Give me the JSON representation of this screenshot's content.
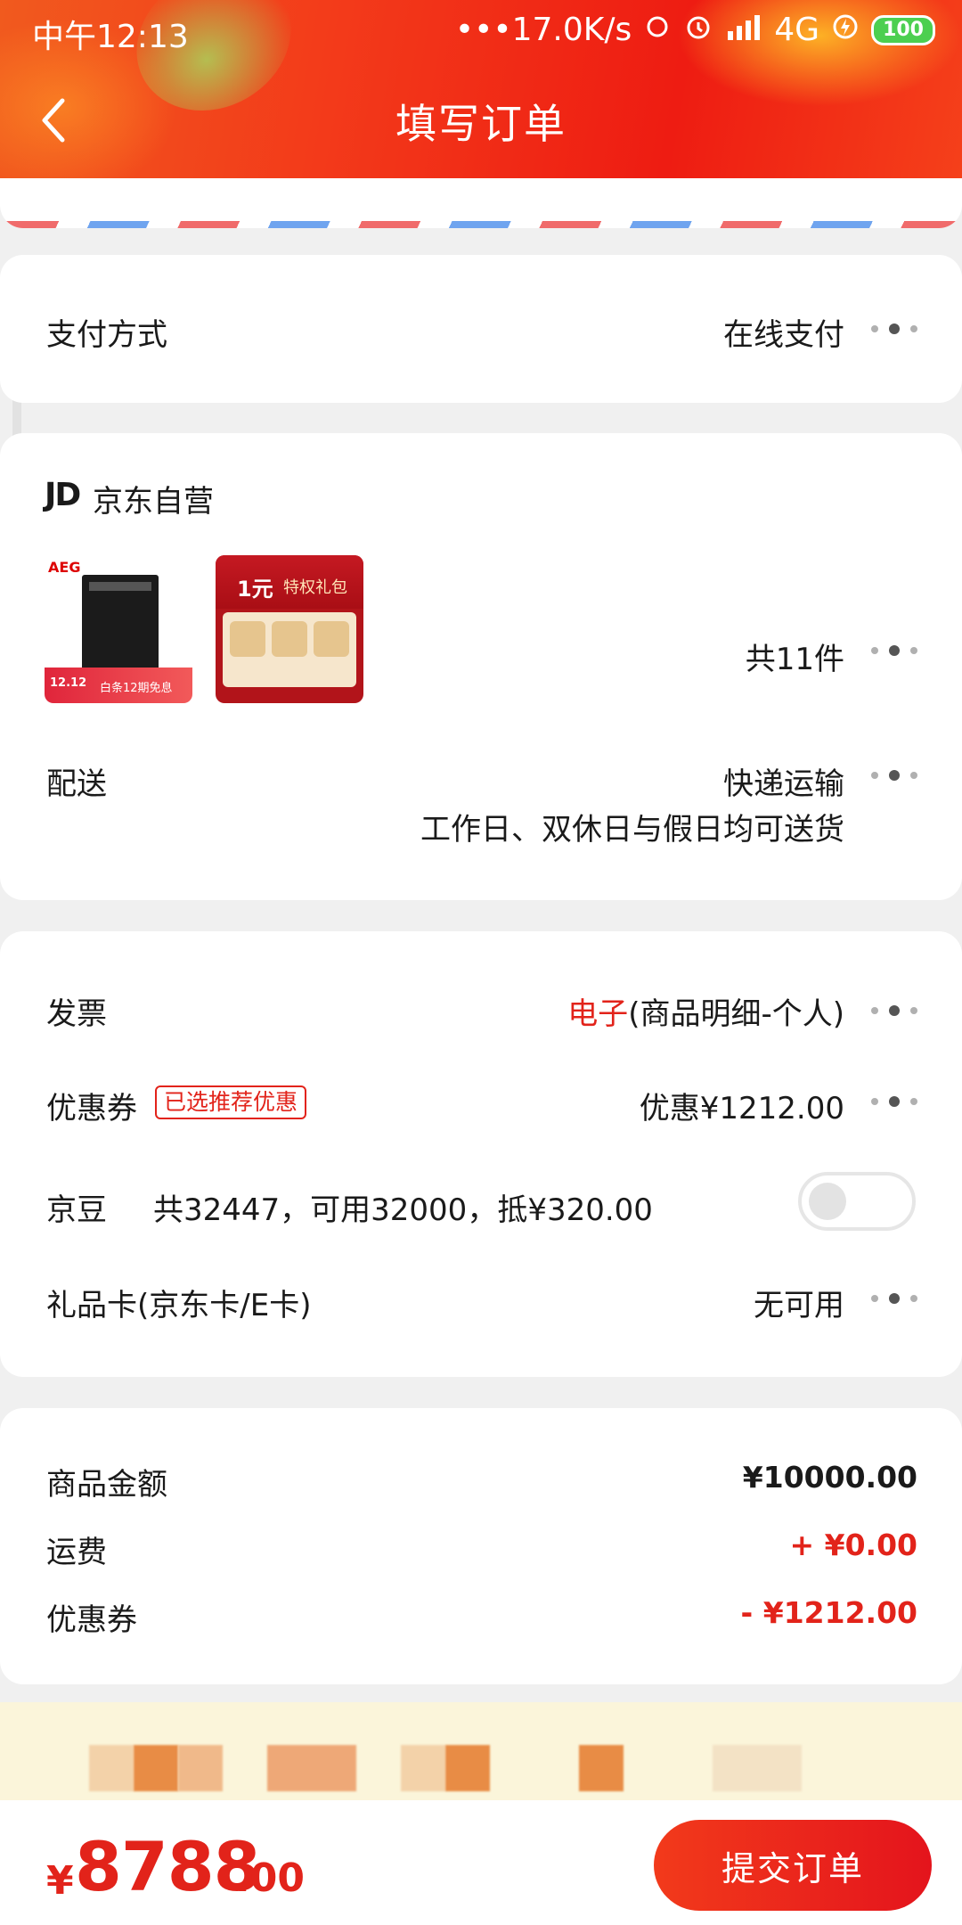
{
  "status_bar": {
    "time": "中午12:13",
    "network_speed": "•••17.0K/s",
    "network": "4G",
    "battery": "100"
  },
  "header": {
    "title": "填写订单"
  },
  "payment": {
    "label": "支付方式",
    "value": "在线支付"
  },
  "store": {
    "logo": "JD",
    "name": "京东自营",
    "product_1_brand": "AEG",
    "product_1_promo_a": "12.12",
    "product_1_promo_b": "白条12期免息",
    "product_2_title": "1元",
    "product_2_subtitle": "特权礼包",
    "item_count": "共11件",
    "delivery_label": "配送",
    "delivery_value": "快递运输",
    "delivery_note": "工作日、双休日与假日均可送货"
  },
  "options": {
    "invoice_label": "发票",
    "invoice_type": "电子",
    "invoice_detail": "(商品明细-个人)",
    "coupon_label": "优惠券",
    "coupon_tag": "已选推荐优惠",
    "coupon_value": "优惠¥1212.00",
    "jingdou_label": "京豆",
    "jingdou_value": "共32447，可用32000，抵¥320.00",
    "jingdou_enabled": false,
    "giftcard_label": "礼品卡(京东卡/E卡)",
    "giftcard_value": "无可用"
  },
  "summary": {
    "goods_label": "商品金额",
    "goods_value": "¥10000.00",
    "shipping_label": "运费",
    "shipping_value": "+ ¥0.00",
    "coupon_label": "优惠券",
    "coupon_value": "- ¥1212.00"
  },
  "footer": {
    "currency": "¥",
    "total_int": "8788",
    "total_dec": ".00",
    "submit_label": "提交订单"
  },
  "colors": {
    "accent": "#e2231a",
    "header": "#f33a1a"
  }
}
